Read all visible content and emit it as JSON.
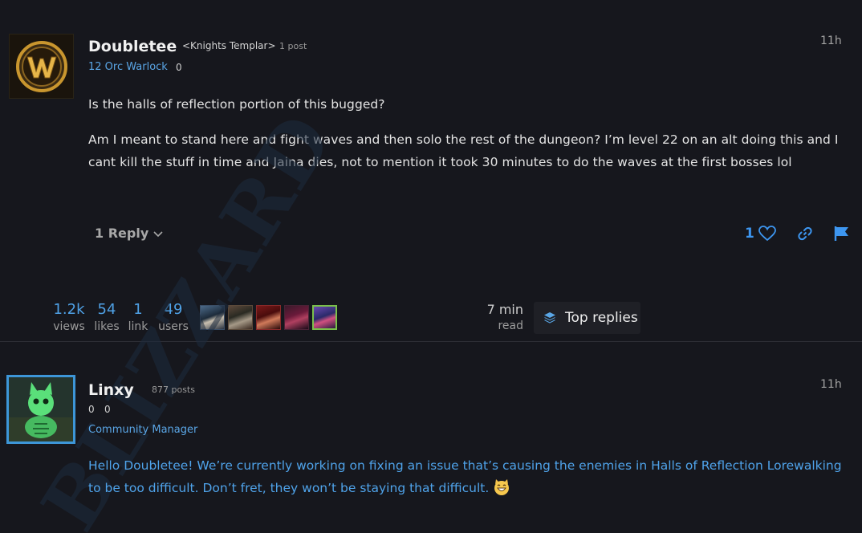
{
  "post1": {
    "username": "Doubletee",
    "guild": "<Knights Templar>",
    "post_count": "1 post",
    "character": "12 Orc Warlock",
    "achievement_points": "0",
    "time": "11h",
    "avatar_icon": "wow-logo-icon",
    "paragraph1": "Is the halls of reflection portion of this bugged?",
    "paragraph2_line1": "Am I meant to stand here and fight waves and then solo the rest of the dungeon? I’m level 22 on an alt doing this and I",
    "paragraph2_line2": "cant kill the stuff in time and Jaina dies, not to mention it took 30 minutes to do the waves at the first bosses lol",
    "reply_label": "1 Reply",
    "like_count": "1",
    "accent_color": "#3d96f0"
  },
  "stats": {
    "views_value": "1.2k",
    "views_label": "views",
    "likes_value": "54",
    "likes_label": "likes",
    "links_value": "1",
    "links_label": "link",
    "users_value": "49",
    "users_label": "users",
    "read_value": "7 min",
    "read_label": "read",
    "top_replies_label": "Top replies"
  },
  "post2": {
    "username": "Linxy",
    "post_count": "877 posts",
    "stat1": "0",
    "stat2": "0",
    "title": "Community Manager",
    "time": "11h",
    "body": "Hello Doubletee! We’re currently working on fixing an issue that’s causing the enemies in Halls of Reflection Lorewalking to be too difficult. Don’t fret, they won’t be staying that difficult.",
    "emoji": "grinning-cat-emoji",
    "watermark": "BLIZZARD",
    "text_color": "#4fa3ea"
  }
}
